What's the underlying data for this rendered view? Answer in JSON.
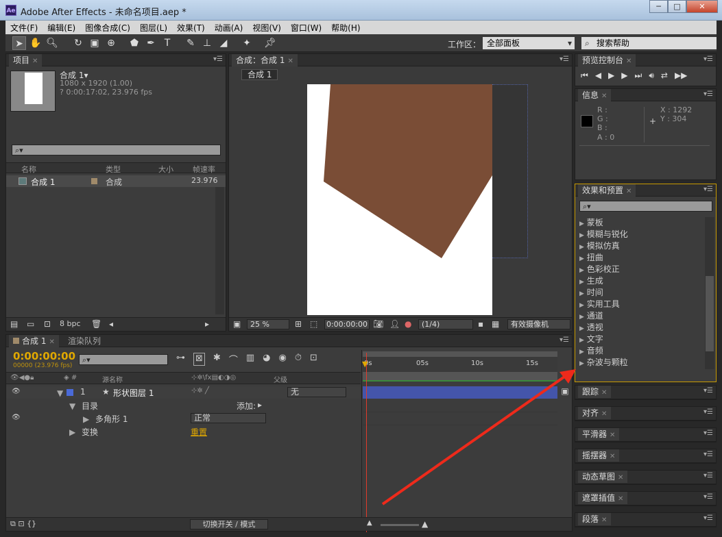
{
  "window": {
    "title": "Adobe After Effects - 未命名项目.aep *",
    "logo": "Ae",
    "min": "─",
    "max": "□",
    "close": "✕"
  },
  "menu": [
    "文件(F)",
    "编辑(E)",
    "图像合成(C)",
    "图层(L)",
    "效果(T)",
    "动画(A)",
    "视图(V)",
    "窗口(W)",
    "帮助(H)"
  ],
  "toolbar": {
    "workspace_label": "工作区：",
    "workspace_value": "全部面板",
    "help_placeholder": "搜索帮助"
  },
  "project": {
    "tab": "项目",
    "comp_name": "合成 1▾",
    "comp_size": "1080 x 1920 (1.00)",
    "comp_dur": "? 0:00:17:02, 23.976 fps",
    "headers": {
      "name": "名称",
      "type": "类型",
      "size": "大小",
      "fps": "帧速率"
    },
    "rows": [
      {
        "name": "合成 1",
        "type": "合成",
        "fps": "23.976"
      }
    ],
    "bpc": "8 bpc"
  },
  "comp": {
    "tab": "合成：合成 1",
    "subtab": "合成 1",
    "zoom": "25 %",
    "time": "0:00:00:00",
    "res": "(1/4)",
    "camera": "有效摄像机"
  },
  "preview": {
    "tab": "预览控制台"
  },
  "info": {
    "tab": "信息",
    "r": "R :",
    "g": "G :",
    "b": "B :",
    "a": "A : 0",
    "x": "X : 1292",
    "y": "Y : 304",
    "plus": "+"
  },
  "effects": {
    "tab": "效果和预置",
    "items": [
      "蒙板",
      "模糊与锐化",
      "模拟仿真",
      "扭曲",
      "色彩校正",
      "生成",
      "时间",
      "实用工具",
      "通道",
      "透视",
      "文字",
      "音频",
      "杂波与颗粒"
    ]
  },
  "side_panels": [
    "跟踪",
    "对齐",
    "平滑器",
    "摇摆器",
    "动态草图",
    "遮罩插值",
    "段落"
  ],
  "timeline": {
    "tab": "合成 1",
    "tab2": "渲染队列",
    "timecode": "0:00:00:00",
    "frames": "00000 (23.976 fps)",
    "col_source": "源名称",
    "col_parent": "父级",
    "layer_num": "1",
    "layer_name": "形状图层 1",
    "parent_value": "无",
    "contents": "目录",
    "add": "添加:",
    "polygon": "多角形 1",
    "blend": "正常",
    "transform": "变换",
    "reset": "重置",
    "ticks": [
      "0s",
      "05s",
      "10s",
      "15s"
    ],
    "footer": "切换开关 / 模式"
  },
  "colors": {
    "shape": "#7a4d36",
    "accent": "#e0a800",
    "layer_bar": "#4455aa",
    "arrow": "#ee2a1b"
  }
}
